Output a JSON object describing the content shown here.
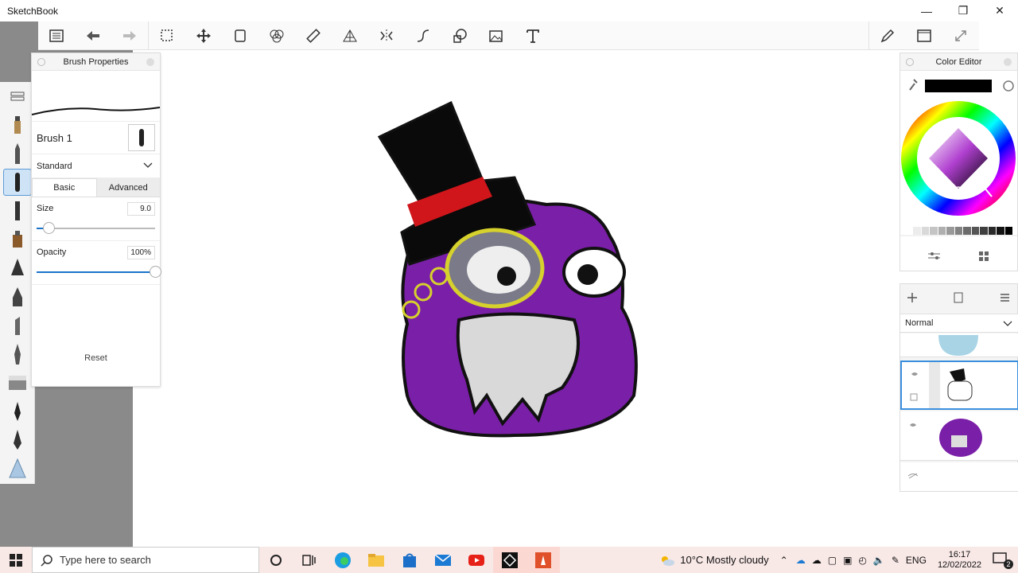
{
  "app": {
    "title": "SketchBook"
  },
  "window_controls": {
    "minimize": "—",
    "maximize": "❐",
    "close": "✕"
  },
  "brush_properties": {
    "title": "Brush Properties",
    "brush_name": "Brush 1",
    "preset": "Standard",
    "tabs": {
      "basic": "Basic",
      "advanced": "Advanced"
    },
    "size_label": "Size",
    "size_value": "9.0",
    "size_fraction": 0.1,
    "opacity_label": "Opacity",
    "opacity_value": "100%",
    "opacity_fraction": 1.0,
    "reset_label": "Reset"
  },
  "color_editor": {
    "title": "Color Editor",
    "current_color": "#000000",
    "swatches": [
      "#ffffff",
      "#ececec",
      "#d9d9d9",
      "#c4c4c4",
      "#afafaf",
      "#999999",
      "#828282",
      "#6b6b6b",
      "#555555",
      "#3f3f3f",
      "#2a2a2a",
      "#141414",
      "#000000"
    ]
  },
  "layers": {
    "blend_mode": "Normal"
  },
  "taskbar": {
    "search_placeholder": "Type here to search",
    "weather": "10°C  Mostly cloudy",
    "language": "ENG",
    "time": "16:17",
    "date": "12/02/2022",
    "notification_count": "2"
  }
}
